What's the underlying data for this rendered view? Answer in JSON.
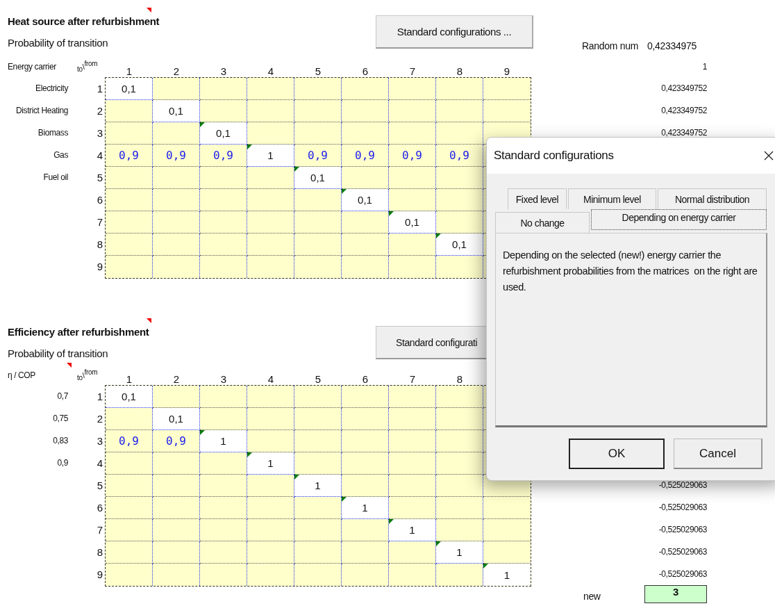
{
  "sections": [
    {
      "title": "Heat source after refurbishment",
      "title_comment": true,
      "subtitle": "Probability of transition",
      "button": {
        "label": "Standard configurations ..."
      },
      "random": {
        "label": "Random num",
        "value": "0,42334975"
      },
      "axis_label": "Energy carrier",
      "axis_comment": false,
      "corner": "$_{to}$\\$^{from}$",
      "columns": [
        "1",
        "2",
        "3",
        "4",
        "5",
        "6",
        "7",
        "8",
        "9"
      ],
      "header_side": "1",
      "rows": [
        {
          "label": "Electricity",
          "number": "1",
          "side": "0,423349752",
          "cells": [
            {
              "kind": "input",
              "value": "0,1",
              "flag": false
            },
            {
              "kind": "empty"
            },
            {
              "kind": "empty"
            },
            {
              "kind": "empty"
            },
            {
              "kind": "empty"
            },
            {
              "kind": "empty"
            },
            {
              "kind": "empty"
            },
            {
              "kind": "empty"
            },
            {
              "kind": "empty"
            }
          ]
        },
        {
          "label": "District Heating",
          "number": "2",
          "side": "0,423349752",
          "cells": [
            {
              "kind": "empty"
            },
            {
              "kind": "input",
              "value": "0,1",
              "flag": false
            },
            {
              "kind": "empty"
            },
            {
              "kind": "empty"
            },
            {
              "kind": "empty"
            },
            {
              "kind": "empty"
            },
            {
              "kind": "empty"
            },
            {
              "kind": "empty"
            },
            {
              "kind": "empty"
            }
          ]
        },
        {
          "label": "Biomass",
          "number": "3",
          "side": "0,423349752",
          "cells": [
            {
              "kind": "empty"
            },
            {
              "kind": "empty"
            },
            {
              "kind": "input",
              "value": "0,1",
              "flag": true
            },
            {
              "kind": "empty"
            },
            {
              "kind": "empty"
            },
            {
              "kind": "empty"
            },
            {
              "kind": "empty"
            },
            {
              "kind": "empty"
            },
            {
              "kind": "empty"
            }
          ]
        },
        {
          "label": "Gas",
          "number": "4",
          "cells": [
            {
              "kind": "calc",
              "value": "0,9"
            },
            {
              "kind": "calc",
              "value": "0,9"
            },
            {
              "kind": "calc",
              "value": "0,9"
            },
            {
              "kind": "input",
              "value": "1",
              "flag": true
            },
            {
              "kind": "calc",
              "value": "0,9"
            },
            {
              "kind": "calc",
              "value": "0,9"
            },
            {
              "kind": "calc",
              "value": "0,9"
            },
            {
              "kind": "calc",
              "value": "0,9"
            },
            {
              "kind": "empty"
            }
          ]
        },
        {
          "label": "Fuel oil",
          "number": "5",
          "cells": [
            {
              "kind": "empty"
            },
            {
              "kind": "empty"
            },
            {
              "kind": "empty"
            },
            {
              "kind": "empty"
            },
            {
              "kind": "input",
              "value": "0,1",
              "flag": true
            },
            {
              "kind": "empty"
            },
            {
              "kind": "empty"
            },
            {
              "kind": "empty"
            },
            {
              "kind": "empty"
            }
          ]
        },
        {
          "number": "6",
          "cells": [
            {
              "kind": "empty"
            },
            {
              "kind": "empty"
            },
            {
              "kind": "empty"
            },
            {
              "kind": "empty"
            },
            {
              "kind": "empty"
            },
            {
              "kind": "input",
              "value": "0,1",
              "flag": true
            },
            {
              "kind": "empty"
            },
            {
              "kind": "empty"
            },
            {
              "kind": "empty"
            }
          ]
        },
        {
          "number": "7",
          "cells": [
            {
              "kind": "empty"
            },
            {
              "kind": "empty"
            },
            {
              "kind": "empty"
            },
            {
              "kind": "empty"
            },
            {
              "kind": "empty"
            },
            {
              "kind": "empty"
            },
            {
              "kind": "input",
              "value": "0,1",
              "flag": true
            },
            {
              "kind": "empty"
            },
            {
              "kind": "empty"
            }
          ]
        },
        {
          "number": "8",
          "cells": [
            {
              "kind": "empty"
            },
            {
              "kind": "empty"
            },
            {
              "kind": "empty"
            },
            {
              "kind": "empty"
            },
            {
              "kind": "empty"
            },
            {
              "kind": "empty"
            },
            {
              "kind": "empty"
            },
            {
              "kind": "input",
              "value": "0,1",
              "flag": true
            },
            {
              "kind": "empty"
            }
          ]
        },
        {
          "number": "9",
          "cells": [
            {
              "kind": "empty"
            },
            {
              "kind": "empty"
            },
            {
              "kind": "empty"
            },
            {
              "kind": "empty"
            },
            {
              "kind": "empty"
            },
            {
              "kind": "empty"
            },
            {
              "kind": "empty"
            },
            {
              "kind": "empty"
            },
            {
              "kind": "empty"
            }
          ]
        }
      ]
    },
    {
      "title": "Efficiency after refurbishment",
      "title_comment": true,
      "subtitle": "Probability of transition",
      "button": {
        "label": "Standard configurati"
      },
      "axis_label": "η / COP",
      "axis_comment": true,
      "corner": "$_{to}$\\$^{from}$",
      "columns": [
        "1",
        "2",
        "3",
        "4",
        "5",
        "6",
        "7",
        "8"
      ],
      "rows": [
        {
          "label": "0,7",
          "number": "1",
          "cells": [
            {
              "kind": "input",
              "value": "0,1",
              "flag": false
            },
            {
              "kind": "empty"
            },
            {
              "kind": "empty"
            },
            {
              "kind": "empty"
            },
            {
              "kind": "empty"
            },
            {
              "kind": "empty"
            },
            {
              "kind": "empty"
            },
            {
              "kind": "empty"
            },
            {
              "kind": "empty"
            }
          ]
        },
        {
          "label": "0,75",
          "number": "2",
          "cells": [
            {
              "kind": "empty"
            },
            {
              "kind": "input",
              "value": "0,1",
              "flag": false
            },
            {
              "kind": "empty"
            },
            {
              "kind": "empty"
            },
            {
              "kind": "empty"
            },
            {
              "kind": "empty"
            },
            {
              "kind": "empty"
            },
            {
              "kind": "empty"
            },
            {
              "kind": "empty"
            }
          ]
        },
        {
          "label": "0,83",
          "number": "3",
          "cells": [
            {
              "kind": "calc",
              "value": "0,9"
            },
            {
              "kind": "calc",
              "value": "0,9"
            },
            {
              "kind": "input",
              "value": "1",
              "flag": true
            },
            {
              "kind": "empty"
            },
            {
              "kind": "empty"
            },
            {
              "kind": "empty"
            },
            {
              "kind": "empty"
            },
            {
              "kind": "empty"
            },
            {
              "kind": "empty"
            }
          ]
        },
        {
          "label": "0,9",
          "number": "4",
          "cells": [
            {
              "kind": "empty"
            },
            {
              "kind": "empty"
            },
            {
              "kind": "empty"
            },
            {
              "kind": "input",
              "value": "1",
              "flag": true
            },
            {
              "kind": "empty"
            },
            {
              "kind": "empty"
            },
            {
              "kind": "empty"
            },
            {
              "kind": "empty"
            },
            {
              "kind": "empty"
            }
          ]
        },
        {
          "number": "5",
          "side": "-0,525029063",
          "cells": [
            {
              "kind": "empty"
            },
            {
              "kind": "empty"
            },
            {
              "kind": "empty"
            },
            {
              "kind": "empty"
            },
            {
              "kind": "input",
              "value": "1",
              "flag": true
            },
            {
              "kind": "empty"
            },
            {
              "kind": "empty"
            },
            {
              "kind": "empty"
            },
            {
              "kind": "empty"
            }
          ]
        },
        {
          "number": "6",
          "side": "-0,525029063",
          "cells": [
            {
              "kind": "empty"
            },
            {
              "kind": "empty"
            },
            {
              "kind": "empty"
            },
            {
              "kind": "empty"
            },
            {
              "kind": "empty"
            },
            {
              "kind": "input",
              "value": "1",
              "flag": true
            },
            {
              "kind": "empty"
            },
            {
              "kind": "empty"
            },
            {
              "kind": "empty"
            }
          ]
        },
        {
          "number": "7",
          "side": "-0,525029063",
          "cells": [
            {
              "kind": "empty"
            },
            {
              "kind": "empty"
            },
            {
              "kind": "empty"
            },
            {
              "kind": "empty"
            },
            {
              "kind": "empty"
            },
            {
              "kind": "empty"
            },
            {
              "kind": "input",
              "value": "1",
              "flag": true
            },
            {
              "kind": "empty"
            },
            {
              "kind": "empty"
            }
          ]
        },
        {
          "number": "8",
          "side": "-0,525029063",
          "cells": [
            {
              "kind": "empty"
            },
            {
              "kind": "empty"
            },
            {
              "kind": "empty"
            },
            {
              "kind": "empty"
            },
            {
              "kind": "empty"
            },
            {
              "kind": "empty"
            },
            {
              "kind": "empty"
            },
            {
              "kind": "input",
              "value": "1",
              "flag": true
            },
            {
              "kind": "empty"
            }
          ]
        },
        {
          "number": "9",
          "side": "-0,525029063",
          "cells": [
            {
              "kind": "empty"
            },
            {
              "kind": "empty"
            },
            {
              "kind": "empty"
            },
            {
              "kind": "empty"
            },
            {
              "kind": "empty"
            },
            {
              "kind": "empty"
            },
            {
              "kind": "empty"
            },
            {
              "kind": "empty"
            },
            {
              "kind": "input",
              "value": "1",
              "flag": true
            }
          ]
        }
      ],
      "result": {
        "label": "new",
        "value": "3"
      }
    }
  ],
  "dialog": {
    "title": "Standard configurations",
    "tab_rows": [
      [
        {
          "label": "Fixed level",
          "selected": false
        },
        {
          "label": "Minimum level",
          "selected": false
        },
        {
          "label": "Normal distribution",
          "selected": false
        }
      ],
      [
        {
          "label": "No change",
          "selected": false
        },
        {
          "label": "Depending on energy carrier",
          "selected": true
        }
      ]
    ],
    "description": "Depending on the selected (new!) energy carrier the refurbishment probabilities from the matrices  on the right are used.",
    "buttons": [
      {
        "label": "OK",
        "default": true
      },
      {
        "label": "Cancel",
        "default": false
      }
    ]
  }
}
